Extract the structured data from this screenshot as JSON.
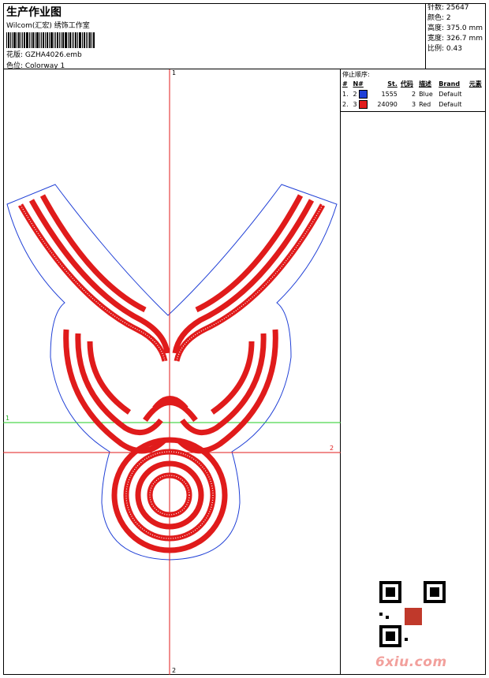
{
  "header": {
    "title": "生产作业图",
    "company": "Wilcom(汇宏) 绣饰工作室",
    "design_label": "花版: GZHA4026.emb",
    "colorway_label": "色位: Colorway 1"
  },
  "stats": [
    {
      "text": "针数: 25647"
    },
    {
      "text": "颜色: 2"
    },
    {
      "text": "高度: 375.0 mm"
    },
    {
      "text": "宽度: 326.7 mm"
    },
    {
      "text": "比例: 0.43"
    }
  ],
  "stop_sequence": {
    "title": "停止顺序:",
    "headers": [
      "#",
      "N#",
      "St.",
      "代码",
      "描述",
      "Brand",
      "元素"
    ],
    "rows": [
      {
        "num": "1.",
        "n": "2",
        "color": "#1f3fd6",
        "st": "1555",
        "code": "2",
        "desc": "Blue",
        "brand": "Default"
      },
      {
        "num": "2.",
        "n": "3",
        "color": "#e01b1b",
        "st": "24090",
        "code": "3",
        "desc": "Red",
        "brand": "Default"
      }
    ]
  },
  "axes": {
    "v_top": "1",
    "v_bottom": "2",
    "h_green": "1",
    "h_red": "2"
  },
  "colors": {
    "blue": "#1f3fd6",
    "red": "#e01b1b",
    "green": "#22cc22"
  },
  "watermark": "6xiu.com"
}
